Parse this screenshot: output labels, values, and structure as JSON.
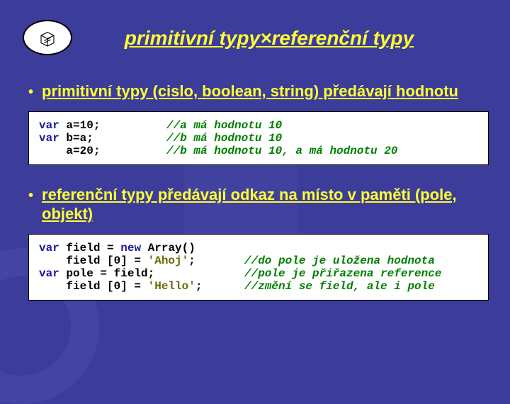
{
  "title": "primitivní typy×referenční typy",
  "bullet1": "primitivní typy (cislo, boolean, string) předávají hodnotu",
  "bullet2": "referenční typy předávají odkaz na místo v paměti (pole, objekt)",
  "code1": {
    "r1c1a": "var",
    "r1c1b": " a=10;",
    "r1c2": "//a má hodnotu 10",
    "r2c1a": "var",
    "r2c1b": " b=a;",
    "r2c2": "//b má hodnotu 10",
    "r3c1": "    a=20;",
    "r3c2": "//b má hodnotu 10, a má hodnotu 20"
  },
  "code2": {
    "r1c1a": "var",
    "r1c1b": " field = ",
    "r1c1c": "new",
    "r1c1d": " Array()",
    "r2c1": "    field [0] = ",
    "r2s": "'Ahoj'",
    "r2e": ";",
    "r2c2": "//do pole je uložena hodnota",
    "r3c1a": "var",
    "r3c1b": " pole = field;",
    "r3c2": "//pole je přiřazena reference",
    "r4c1": "    field [0] = ",
    "r4s": "'Hello'",
    "r4e": ";",
    "r4c2": "//změní se field, ale i pole"
  },
  "chart_data": {
    "type": "table",
    "title": "primitivní typy×referenční typy",
    "sections": [
      {
        "heading": "primitivní typy (cislo, boolean, string) předávají hodnotu",
        "code": [
          {
            "code": "var a=10;",
            "comment": "//a má hodnotu 10"
          },
          {
            "code": "var b=a;",
            "comment": "//b má hodnotu 10"
          },
          {
            "code": "    a=20;",
            "comment": "//b má hodnotu 10, a má hodnotu 20"
          }
        ]
      },
      {
        "heading": "referenční typy předávají odkaz na místo v paměti (pole, objekt)",
        "code": [
          {
            "code": "var field = new Array()",
            "comment": ""
          },
          {
            "code": "    field [0] = 'Ahoj';",
            "comment": "//do pole je uložena hodnota"
          },
          {
            "code": "var pole = field;",
            "comment": "//pole je přiřazena reference"
          },
          {
            "code": "    field [0] = 'Hello';",
            "comment": "//změní se field, ale i pole"
          }
        ]
      }
    ]
  }
}
